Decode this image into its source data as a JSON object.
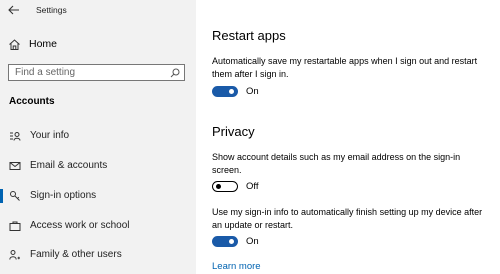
{
  "window": {
    "title": "Settings"
  },
  "sidebar": {
    "home_label": "Home",
    "search_placeholder": "Find a setting",
    "section_title": "Accounts",
    "items": [
      {
        "label": "Your info",
        "icon": "person-card-icon",
        "selected": false
      },
      {
        "label": "Email & accounts",
        "icon": "mail-icon",
        "selected": false
      },
      {
        "label": "Sign-in options",
        "icon": "key-icon",
        "selected": true
      },
      {
        "label": "Access work or school",
        "icon": "briefcase-icon",
        "selected": false
      },
      {
        "label": "Family & other users",
        "icon": "people-icon",
        "selected": false
      }
    ]
  },
  "main": {
    "restart": {
      "heading": "Restart apps",
      "description": "Automatically save my restartable apps when I sign out and restart them after I sign in.",
      "toggle_state": "On"
    },
    "privacy": {
      "heading": "Privacy",
      "account_details": {
        "description": "Show account details such as my email address on the sign-in screen.",
        "toggle_state": "Off"
      },
      "signin_info": {
        "description": "Use my sign-in info to automatically finish setting up my device after an update or restart.",
        "toggle_state": "On"
      },
      "learn_more": "Learn more"
    }
  },
  "colors": {
    "accent": "#1a5aa8",
    "link": "#0063b1",
    "sidebar_bg": "#f2f2f2"
  }
}
